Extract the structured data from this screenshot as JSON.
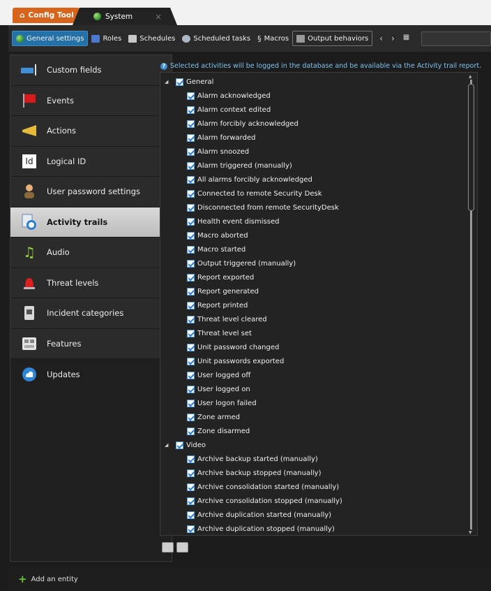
{
  "tabs": {
    "config_tool": "Config Tool",
    "system": "System"
  },
  "toolbar": {
    "items": [
      "General settings",
      "Roles",
      "Schedules",
      "Scheduled tasks",
      "Macros",
      "Output behaviors"
    ]
  },
  "sidebar": {
    "items": [
      {
        "label": "Custom fields",
        "icon": "custom-fields-icon"
      },
      {
        "label": "Events",
        "icon": "flag-icon"
      },
      {
        "label": "Actions",
        "icon": "megaphone-icon"
      },
      {
        "label": "Logical ID",
        "icon": "id-icon"
      },
      {
        "label": "User password settings",
        "icon": "user-icon"
      },
      {
        "label": "Activity trails",
        "icon": "activity-trail-icon"
      },
      {
        "label": "Audio",
        "icon": "music-note-icon"
      },
      {
        "label": "Threat levels",
        "icon": "siren-icon"
      },
      {
        "label": "Incident categories",
        "icon": "incident-icon"
      },
      {
        "label": "Features",
        "icon": "features-icon"
      },
      {
        "label": "Updates",
        "icon": "cloud-update-icon"
      }
    ],
    "selected": "Activity trails"
  },
  "info_text": "Selected activities will be logged in the database and be available via the Activity trail report.",
  "tree": {
    "general": {
      "label": "General",
      "items": [
        "Alarm acknowledged",
        "Alarm context edited",
        "Alarm forcibly acknowledged",
        "Alarm forwarded",
        "Alarm snoozed",
        "Alarm triggered (manually)",
        "All alarms forcibly acknowledged",
        "Connected to remote Security Desk",
        "Disconnected from remote SecurityDesk",
        "Health event dismissed",
        "Macro aborted",
        "Macro started",
        "Output triggered (manually)",
        "Report exported",
        "Report generated",
        "Report printed",
        "Threat level cleared",
        "Threat level set",
        "Unit password changed",
        "Unit passwords exported",
        "User logged off",
        "User logged on",
        "User logon failed",
        "Zone armed",
        "Zone disarmed"
      ]
    },
    "video": {
      "label": "Video",
      "items": [
        "Archive backup started (manually)",
        "Archive backup stopped (manually)",
        "Archive consolidation started (manually)",
        "Archive consolidation stopped (manually)",
        "Archive duplication started (manually)",
        "Archive duplication stopped (manually)"
      ]
    }
  },
  "footer": {
    "add_entity": "Add an entity"
  },
  "colors": {
    "accent": "#2471a8",
    "config_tab": "#d8641c",
    "selected_item": "#cfcfcf",
    "info_text": "#7ec3ef"
  }
}
